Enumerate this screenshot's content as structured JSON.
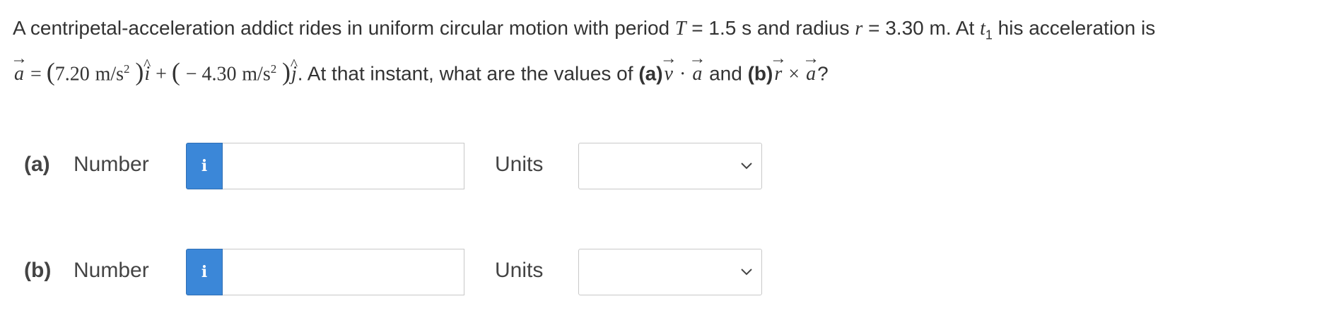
{
  "question": {
    "intro": "A centripetal-acceleration addict rides in uniform circular motion with period ",
    "T_symbol": "T",
    "T_value": " = 1.5 s and radius ",
    "r_symbol": "r",
    "r_value": " = 3.30 m. At ",
    "t_symbol": "t",
    "t_sub": "1",
    "his_accel": " his acceleration is",
    "a_symbol": "a",
    "equals": " = ",
    "comp1_value": "7.20",
    "unit": "m/s",
    "unit_exp": "2",
    "i_hat": "i",
    "plus": " + ",
    "minus": "− ",
    "comp2_value": "4.30",
    "j_hat": "j",
    "after_eq": ". At that instant, what are the values of ",
    "part_a_label": "(a)",
    "v_symbol": "v",
    "dot": " · ",
    "and": " and ",
    "part_b_label": "(b)",
    "cross": " × ",
    "qmark": "?"
  },
  "parts": [
    {
      "label": "(a)",
      "number_label": "Number",
      "info_icon": "i",
      "number_value": "",
      "units_label": "Units",
      "units_selected": ""
    },
    {
      "label": "(b)",
      "number_label": "Number",
      "info_icon": "i",
      "number_value": "",
      "units_label": "Units",
      "units_selected": ""
    }
  ],
  "colors": {
    "info_button": "#3b87d8",
    "text": "#333333",
    "border": "#c8c8c8"
  }
}
